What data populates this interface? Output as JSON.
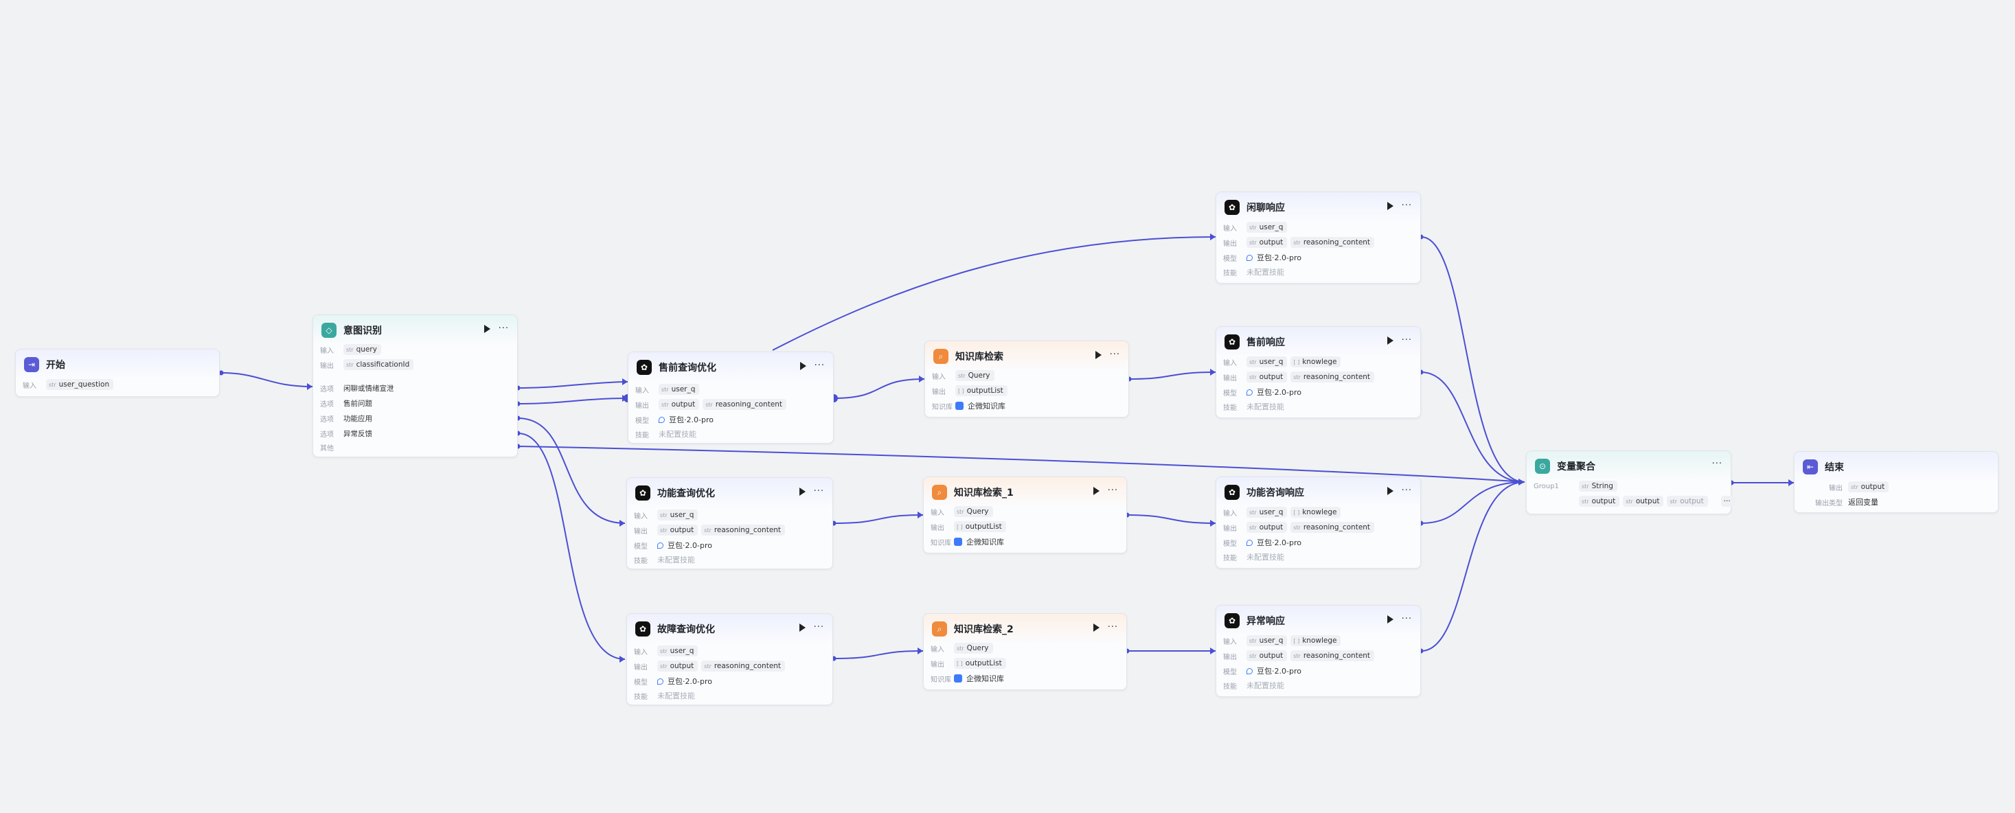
{
  "labels": {
    "input": "输入",
    "output": "输出",
    "option": "选项",
    "other": "其他",
    "model": "模型",
    "skill": "技能",
    "kb": "知识库",
    "output_type": "输出类型"
  },
  "types": {
    "str": "str",
    "list": "[ ]",
    "str_list": "[ ]"
  },
  "nodes": {
    "start": {
      "title": "开始",
      "input_var": "user_question"
    },
    "intent": {
      "title": "意图识别",
      "input_var": "query",
      "output_var": "classificationId",
      "options": [
        "闲聊或情绪宣泄",
        "售前问题",
        "功能应用",
        "异常反馈"
      ]
    },
    "presale_opt": {
      "title": "售前查询优化",
      "input_var": "user_q",
      "output_vars": [
        "output",
        "reasoning_content"
      ],
      "model": "豆包·2.0-pro",
      "skill": "未配置技能"
    },
    "func_opt": {
      "title": "功能查询优化",
      "input_var": "user_q",
      "output_vars": [
        "output",
        "reasoning_content"
      ],
      "model": "豆包·2.0-pro",
      "skill": "未配置技能"
    },
    "fault_opt": {
      "title": "故障查询优化",
      "input_var": "user_q",
      "output_vars": [
        "output",
        "reasoning_content"
      ],
      "model": "豆包·2.0-pro",
      "skill": "未配置技能"
    },
    "kb0": {
      "title": "知识库检索",
      "input_var": "Query",
      "output_var": "outputList",
      "kb": "企微知识库"
    },
    "kb1": {
      "title": "知识库检索_1",
      "input_var": "Query",
      "output_var": "outputList",
      "kb": "企微知识库"
    },
    "kb2": {
      "title": "知识库检索_2",
      "input_var": "Query",
      "output_var": "outputList",
      "kb": "企微知识库"
    },
    "chat_resp": {
      "title": "闲聊响应",
      "input_vars": [
        "user_q"
      ],
      "output_vars": [
        "output",
        "reasoning_content"
      ],
      "model": "豆包·2.0-pro",
      "skill": "未配置技能"
    },
    "presale_resp": {
      "title": "售前响应",
      "input_vars": [
        "user_q",
        "knowlege"
      ],
      "output_vars": [
        "output",
        "reasoning_content"
      ],
      "model": "豆包·2.0-pro",
      "skill": "未配置技能"
    },
    "func_resp": {
      "title": "功能咨询响应",
      "input_vars": [
        "user_q",
        "knowlege"
      ],
      "output_vars": [
        "output",
        "reasoning_content"
      ],
      "model": "豆包·2.0-pro",
      "skill": "未配置技能"
    },
    "err_resp": {
      "title": "异常响应",
      "input_vars": [
        "user_q",
        "knowlege"
      ],
      "output_vars": [
        "output",
        "reasoning_content"
      ],
      "model": "豆包·2.0-pro",
      "skill": "未配置技能"
    },
    "agg": {
      "title": "变量聚合",
      "group": "Group1",
      "group_type": "String",
      "vars": [
        "output",
        "output",
        "output"
      ],
      "more": "···"
    },
    "end": {
      "title": "结束",
      "output_var": "output",
      "output_type": "返回变量"
    }
  },
  "colors": {
    "edge": "#4a4fd4",
    "background": "#f1f2f4"
  }
}
